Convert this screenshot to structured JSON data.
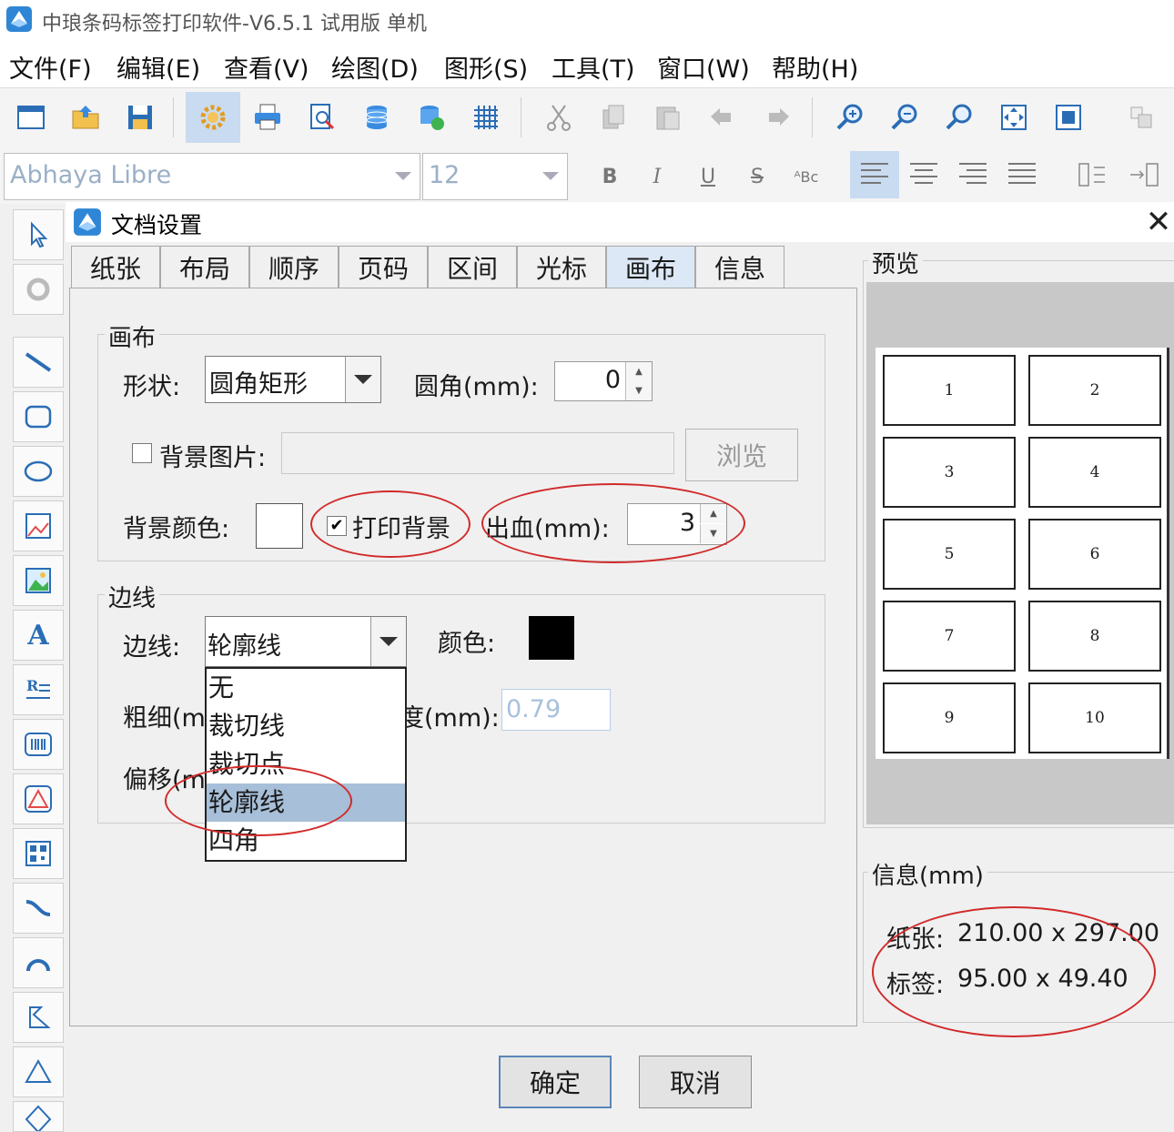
{
  "window": {
    "title": "中琅条码标签打印软件-V6.5.1 试用版 单机"
  },
  "menu": [
    "文件(F)",
    "编辑(E)",
    "查看(V)",
    "绘图(D)",
    "图形(S)",
    "工具(T)",
    "窗口(W)",
    "帮助(H)"
  ],
  "format": {
    "font_name": "Abhaya Libre",
    "font_size": "12",
    "bold": "B",
    "italic": "I",
    "underline": "U",
    "strike": "S",
    "case": "ᴬBc"
  },
  "dialog": {
    "title": "文档设置",
    "close": "✕",
    "tabs": [
      "纸张",
      "布局",
      "顺序",
      "页码",
      "区间",
      "光标",
      "画布",
      "信息"
    ],
    "canvas_group": {
      "title": "画布",
      "shape_label": "形状:",
      "shape_value": "圆角矩形",
      "radius_label": "圆角(mm):",
      "radius_value": "0",
      "bg_image_label": "背景图片:",
      "browse": "浏览",
      "bg_color_label": "背景颜色:",
      "print_bg_label": "打印背景",
      "print_bg_checked": "✔",
      "bleed_label": "出血(mm):",
      "bleed_value": "3"
    },
    "border_group": {
      "title": "边线",
      "border_label": "边线:",
      "border_value": "轮廓线",
      "color_label": "颜色:",
      "color_value": "#000000",
      "thickness_label_partial": "粗细(m",
      "width_label_partial": "度(mm):",
      "width_value": "0.79",
      "offset_label_partial": "偏移(m",
      "options": [
        "无",
        "裁切线",
        "裁切点",
        "轮廓线",
        "四角"
      ],
      "selected_option": "轮廓线"
    },
    "preview": {
      "title": "预览",
      "cells": [
        "1",
        "2",
        "3",
        "4",
        "5",
        "6",
        "7",
        "8",
        "9",
        "10"
      ]
    },
    "info": {
      "title": "信息(mm)",
      "paper_label": "纸张:",
      "paper_value": "210.00 x 297.00",
      "label_label": "标签:",
      "label_value": "95.00 x 49.40"
    },
    "ok": "确定",
    "cancel": "取消"
  },
  "colors": {
    "accent_tab": "#dce8f5",
    "highlight_red": "#d22a2a",
    "selection": "#a7bfd8"
  }
}
